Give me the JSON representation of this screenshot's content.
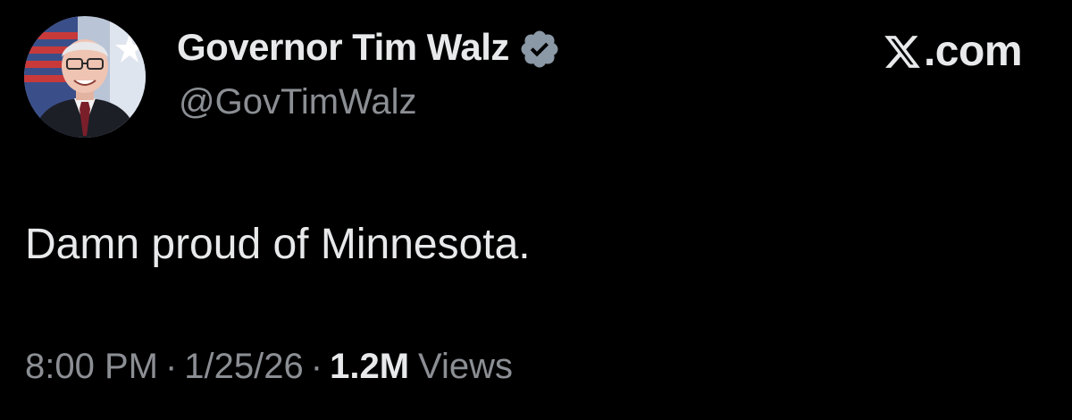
{
  "tweet": {
    "author": {
      "display_name": "Governor Tim Walz",
      "handle": "@GovTimWalz",
      "verified": true,
      "verified_badge_color": "#8b98a5",
      "avatar_icon": "profile-photo"
    },
    "brand": {
      "icon": "x-logo-icon",
      "text": ".com"
    },
    "text": "Damn proud of Minnesota.",
    "meta": {
      "time": "8:00 PM",
      "separator": "·",
      "date": "1/25/26",
      "views_count": "1.2M",
      "views_label": "Views"
    }
  },
  "colors": {
    "background": "#000000",
    "primary_text": "#e7e9ea",
    "secondary_text": "#8b8f94"
  }
}
